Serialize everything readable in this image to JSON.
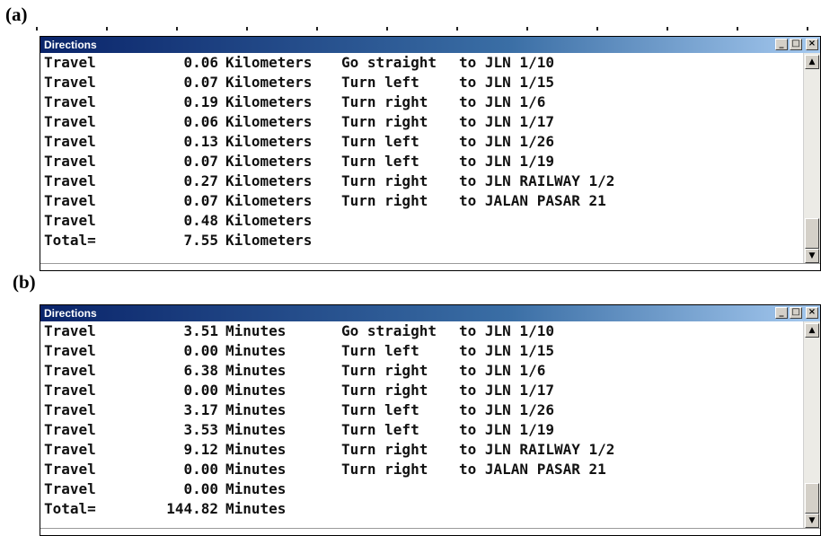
{
  "panels": [
    {
      "label": "(a)",
      "window": {
        "title": "Directions",
        "controls": {
          "minimize": "_",
          "maximize": "□",
          "close": "×"
        },
        "rows": [
          {
            "action": "Travel",
            "value": "0.06",
            "unit": "Kilometers",
            "turn": "Go straight",
            "to": "to JLN 1/10"
          },
          {
            "action": "Travel",
            "value": "0.07",
            "unit": "Kilometers",
            "turn": "Turn left",
            "to": "to JLN 1/15"
          },
          {
            "action": "Travel",
            "value": "0.19",
            "unit": "Kilometers",
            "turn": "Turn right",
            "to": "to JLN 1/6"
          },
          {
            "action": "Travel",
            "value": "0.06",
            "unit": "Kilometers",
            "turn": "Turn right",
            "to": "to JLN 1/17"
          },
          {
            "action": "Travel",
            "value": "0.13",
            "unit": "Kilometers",
            "turn": "Turn left",
            "to": "to JLN 1/26"
          },
          {
            "action": "Travel",
            "value": "0.07",
            "unit": "Kilometers",
            "turn": "Turn left",
            "to": "to JLN 1/19"
          },
          {
            "action": "Travel",
            "value": "0.27",
            "unit": "Kilometers",
            "turn": "Turn right",
            "to": "to JLN RAILWAY 1/2"
          },
          {
            "action": "Travel",
            "value": "0.07",
            "unit": "Kilometers",
            "turn": "Turn right",
            "to": "to JALAN PASAR 21"
          },
          {
            "action": "Travel",
            "value": "0.48",
            "unit": "Kilometers",
            "turn": "",
            "to": ""
          },
          {
            "action": "Total=",
            "value": "7.55",
            "unit": "Kilometers",
            "turn": "",
            "to": ""
          }
        ],
        "scroll_up_icon": "▲",
        "scroll_down_icon": "▼"
      }
    },
    {
      "label": "(b)",
      "window": {
        "title": "Directions",
        "controls": {
          "minimize": "_",
          "maximize": "□",
          "close": "×"
        },
        "rows": [
          {
            "action": "Travel",
            "value": "3.51",
            "unit": "Minutes",
            "turn": "Go straight",
            "to": "to JLN 1/10"
          },
          {
            "action": "Travel",
            "value": "0.00",
            "unit": "Minutes",
            "turn": "Turn left",
            "to": "to JLN 1/15"
          },
          {
            "action": "Travel",
            "value": "6.38",
            "unit": "Minutes",
            "turn": "Turn right",
            "to": "to JLN 1/6"
          },
          {
            "action": "Travel",
            "value": "0.00",
            "unit": "Minutes",
            "turn": "Turn right",
            "to": "to JLN 1/17"
          },
          {
            "action": "Travel",
            "value": "3.17",
            "unit": "Minutes",
            "turn": "Turn left",
            "to": "to JLN 1/26"
          },
          {
            "action": "Travel",
            "value": "3.53",
            "unit": "Minutes",
            "turn": "Turn left",
            "to": "to JLN 1/19"
          },
          {
            "action": "Travel",
            "value": "9.12",
            "unit": "Minutes",
            "turn": "Turn right",
            "to": "to JLN RAILWAY 1/2"
          },
          {
            "action": "Travel",
            "value": "0.00",
            "unit": "Minutes",
            "turn": "Turn right",
            "to": "to JALAN PASAR 21"
          },
          {
            "action": "Travel",
            "value": "0.00",
            "unit": "Minutes",
            "turn": "",
            "to": ""
          },
          {
            "action": "Total=",
            "value": "144.82",
            "unit": "Minutes",
            "turn": "",
            "to": ""
          }
        ],
        "scroll_up_icon": "▲",
        "scroll_down_icon": "▼"
      }
    }
  ],
  "colors": {
    "titlebar_start": "#0a246a",
    "titlebar_end": "#a6caf0",
    "button_face": "#d4d0c8"
  }
}
